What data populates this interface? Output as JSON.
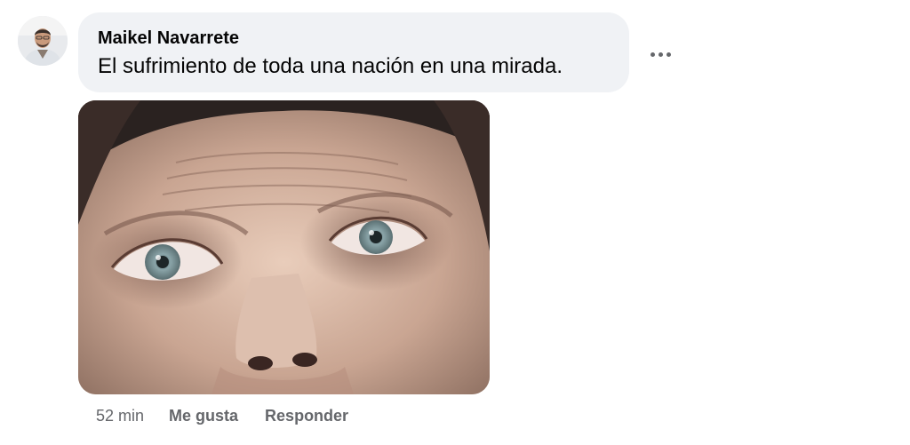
{
  "comment": {
    "author": "Maikel Navarrete",
    "text": "El sufrimiento de toda una nación en una mirada.",
    "avatar_icon": "profile-photo",
    "more_icon": "more-horizontal-icon"
  },
  "attachment": {
    "type": "photo"
  },
  "actions": {
    "timestamp": "52 min",
    "like_label": "Me gusta",
    "reply_label": "Responder"
  },
  "colors": {
    "bubble_bg": "#f0f2f5",
    "primary_text": "#050505",
    "secondary_text": "#65676b"
  }
}
